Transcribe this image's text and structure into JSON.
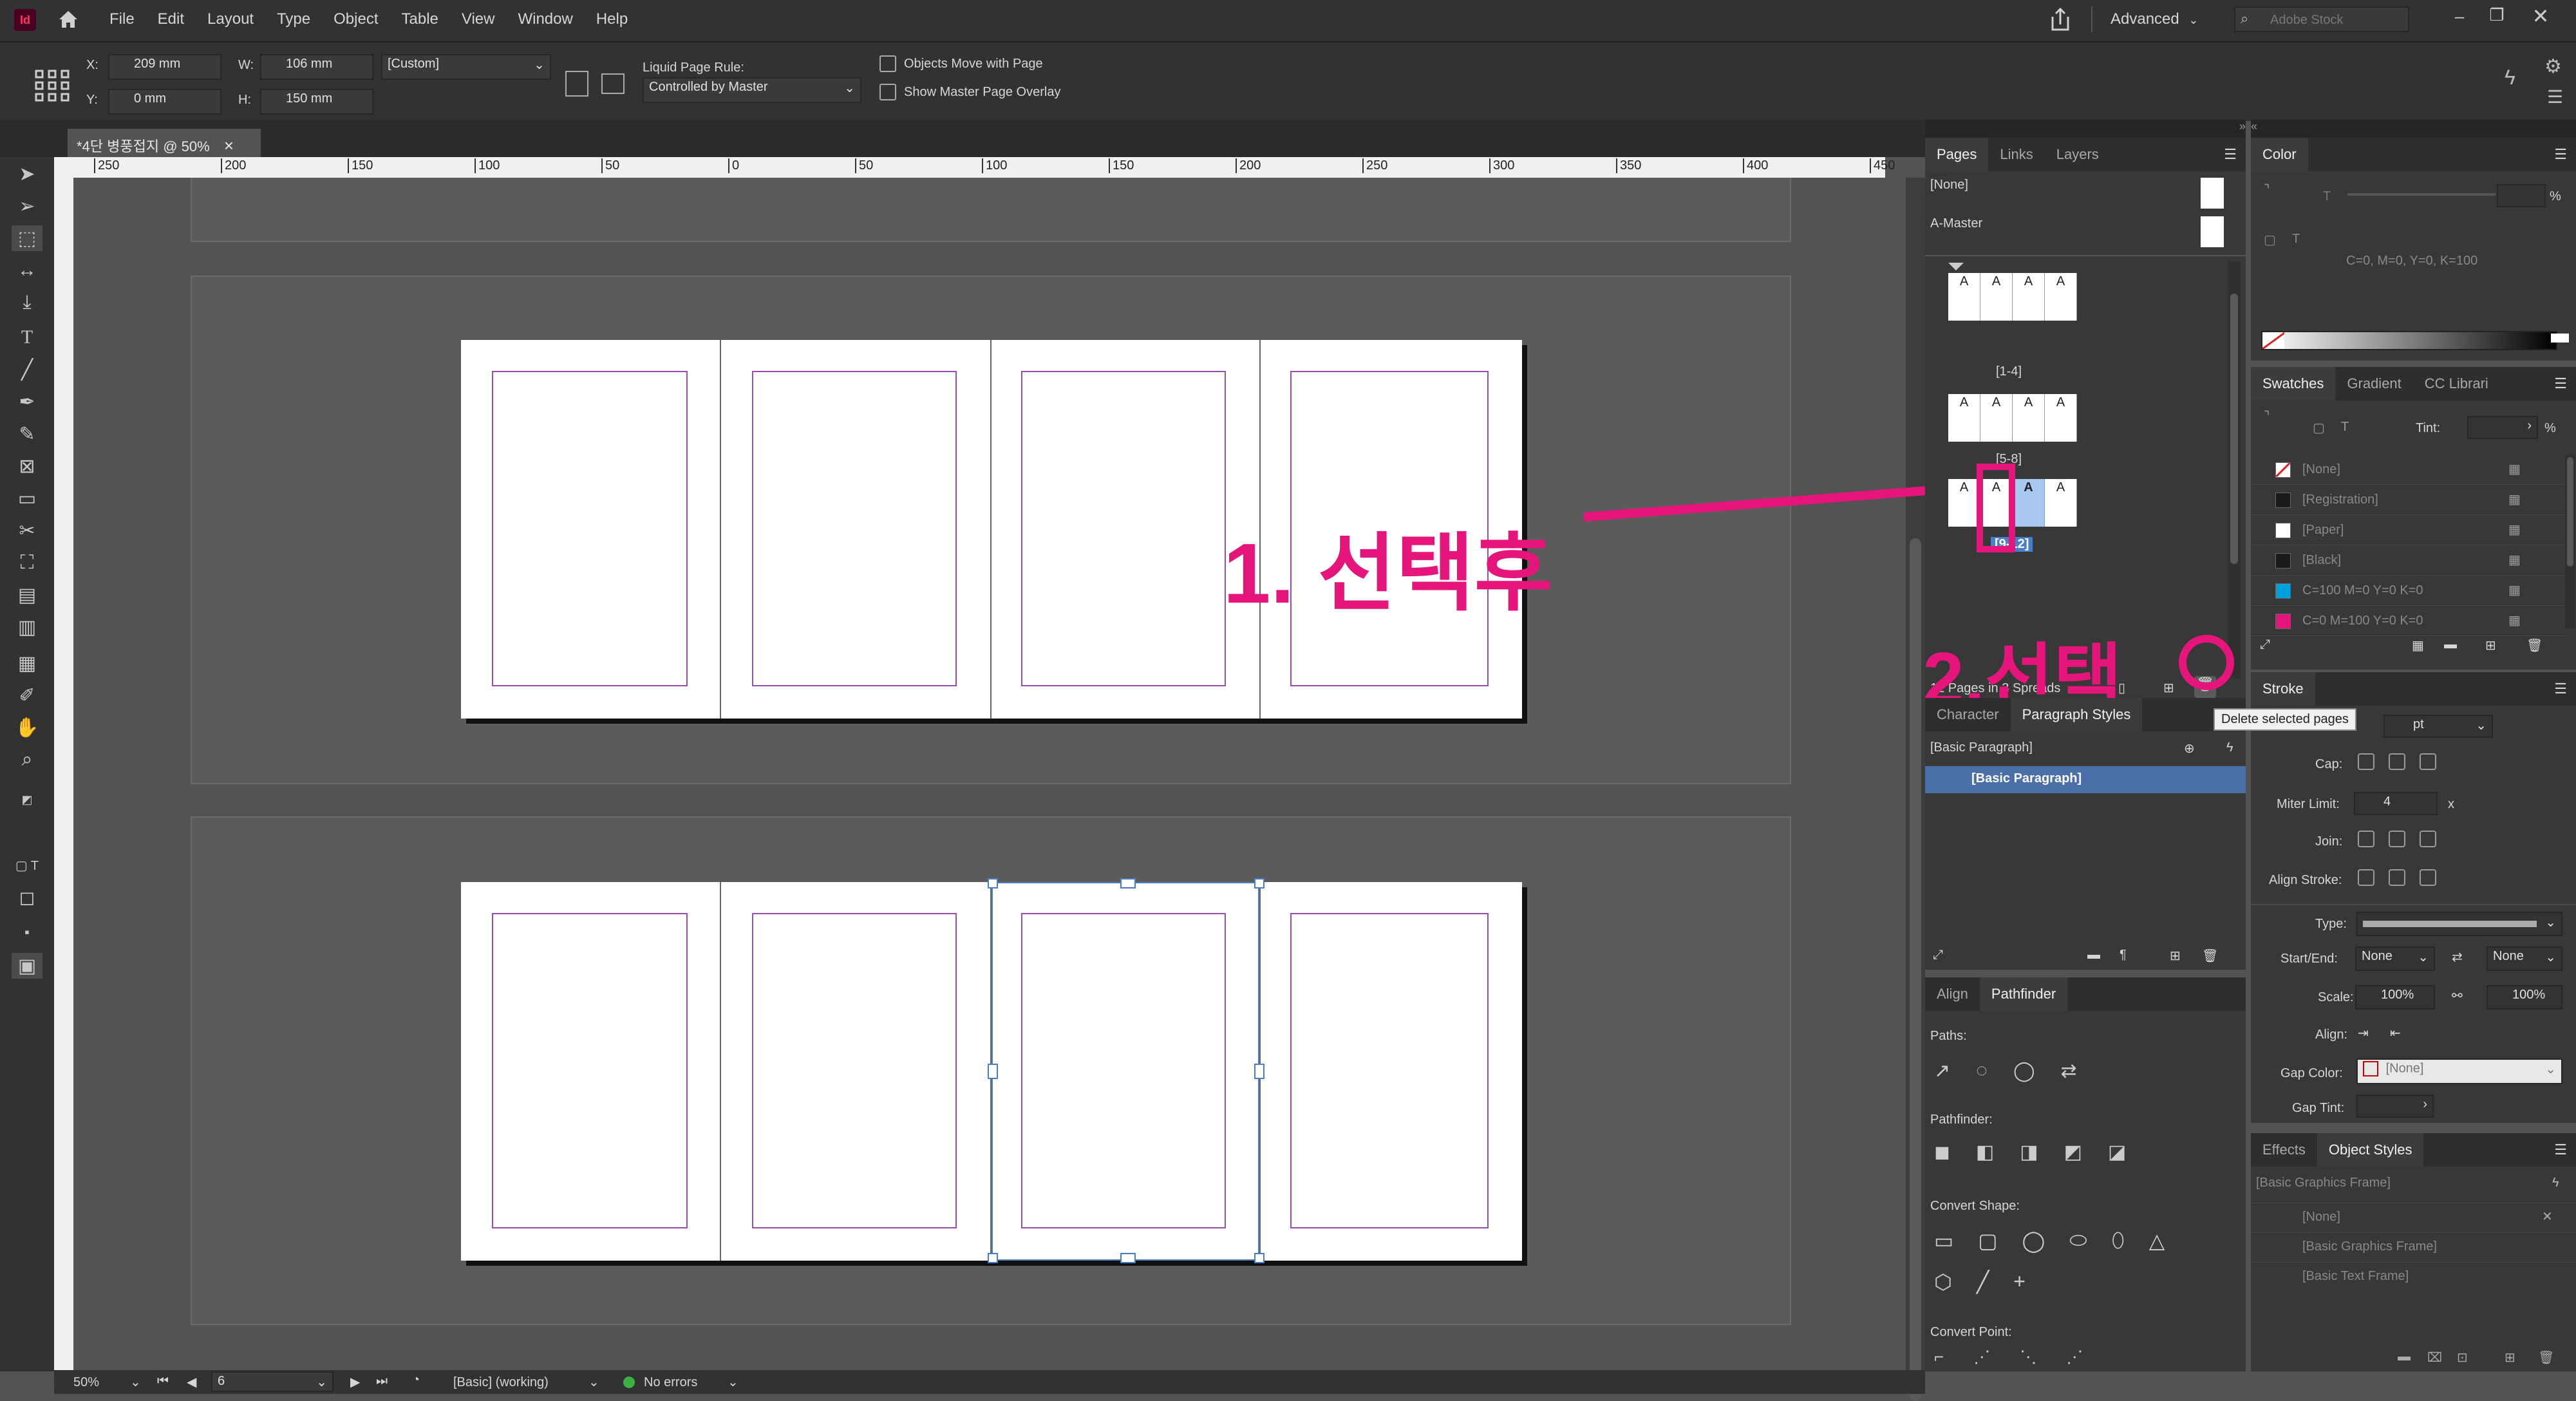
{
  "menubar": {
    "app_badge": "Id",
    "menus": [
      "File",
      "Edit",
      "Layout",
      "Type",
      "Object",
      "Table",
      "View",
      "Window",
      "Help"
    ],
    "workspace": "Advanced",
    "search_placeholder": "Adobe Stock"
  },
  "control_bar": {
    "x_label": "X:",
    "x_value": "209 mm",
    "y_label": "Y:",
    "y_value": "0 mm",
    "w_label": "W:",
    "w_value": "106 mm",
    "h_label": "H:",
    "h_value": "150 mm",
    "size_preset": "[Custom]",
    "liquid_label": "Liquid Page Rule:",
    "liquid_value": "Controlled by Master",
    "objects_move": "Objects Move with Page",
    "show_overlay": "Show Master Page Overlay"
  },
  "document_tab": {
    "title": "*4단 병풍접지 @ 50%",
    "close": "×"
  },
  "ruler": {
    "labels": [
      "250",
      "200",
      "150",
      "100",
      "50",
      "0",
      "50",
      "100",
      "150",
      "200",
      "250",
      "300",
      "350",
      "400",
      "450"
    ]
  },
  "annotations": {
    "step1": "1. 선택후",
    "step2": "2.선택"
  },
  "pages_panel": {
    "tabs": [
      "Pages",
      "Links",
      "Layers"
    ],
    "masters": [
      "[None]",
      "A-Master"
    ],
    "spreads": [
      {
        "label": "[1-4]",
        "pages": [
          "A",
          "A",
          "A",
          "A"
        ]
      },
      {
        "label": "[5-8]",
        "pages": [
          "A",
          "A",
          "A",
          "A"
        ]
      },
      {
        "label": "[9-12]",
        "pages": [
          "A",
          "A",
          "A",
          "A"
        ]
      }
    ],
    "status_text": "12 Pages in 3 Spreads",
    "tooltip": "Delete selected pages"
  },
  "styles_panel": {
    "tabs": [
      "Character",
      "Paragraph Styles"
    ],
    "header_item": "[Basic Paragraph]",
    "items": [
      "[Basic Paragraph]"
    ]
  },
  "align_panel": {
    "tabs": [
      "Align",
      "Pathfinder"
    ],
    "paths_label": "Paths:",
    "pathfinder_label": "Pathfinder:",
    "convert_shape_label": "Convert Shape:",
    "convert_point_label": "Convert Point:"
  },
  "color_panel": {
    "title": "Color",
    "values": "C=0, M=0, Y=0, K=100",
    "percent": "%"
  },
  "swatches_panel": {
    "tabs": [
      "Swatches",
      "Gradient",
      "CC Librari"
    ],
    "tint_label": "Tint:",
    "percent": "%",
    "items": [
      {
        "name": "[None]",
        "color": "#ffffff"
      },
      {
        "name": "[Registration]",
        "color": "#1a1a1a"
      },
      {
        "name": "[Paper]",
        "color": "#ffffff"
      },
      {
        "name": "[Black]",
        "color": "#1a1a1a"
      },
      {
        "name": "C=100 M=0 Y=0 K=0",
        "color": "#00a0e0"
      },
      {
        "name": "C=0 M=100 Y=0 K=0",
        "color": "#e5157b"
      }
    ]
  },
  "stroke_panel": {
    "title": "Stroke",
    "weight_unit": "pt",
    "cap_label": "Cap:",
    "miter_label": "Miter Limit:",
    "miter_value": "4",
    "miter_x": "x",
    "join_label": "Join:",
    "align_label": "Align Stroke:",
    "type_label": "Type:",
    "start_end_label": "Start/End:",
    "start_value": "None",
    "end_value": "None",
    "scale_label": "Scale:",
    "scale_start": "100%",
    "scale_end": "100%",
    "align2_label": "Align:",
    "gap_color_label": "Gap Color:",
    "gap_color_value": "[None]",
    "gap_tint_label": "Gap Tint:"
  },
  "object_styles_panel": {
    "tabs": [
      "Effects",
      "Object Styles"
    ],
    "header_item": "[Basic Graphics Frame]",
    "items": [
      "[None]",
      "[Basic Graphics Frame]",
      "[Basic Text Frame]"
    ]
  },
  "status_bar": {
    "zoom": "50%",
    "page_field": "6",
    "preflight_profile": "[Basic] (working)",
    "errors": "No errors"
  },
  "colors": {
    "accent_magenta": "#e5157b",
    "selection_blue": "#4a7ec8",
    "margin_purple": "#9a4db0"
  }
}
